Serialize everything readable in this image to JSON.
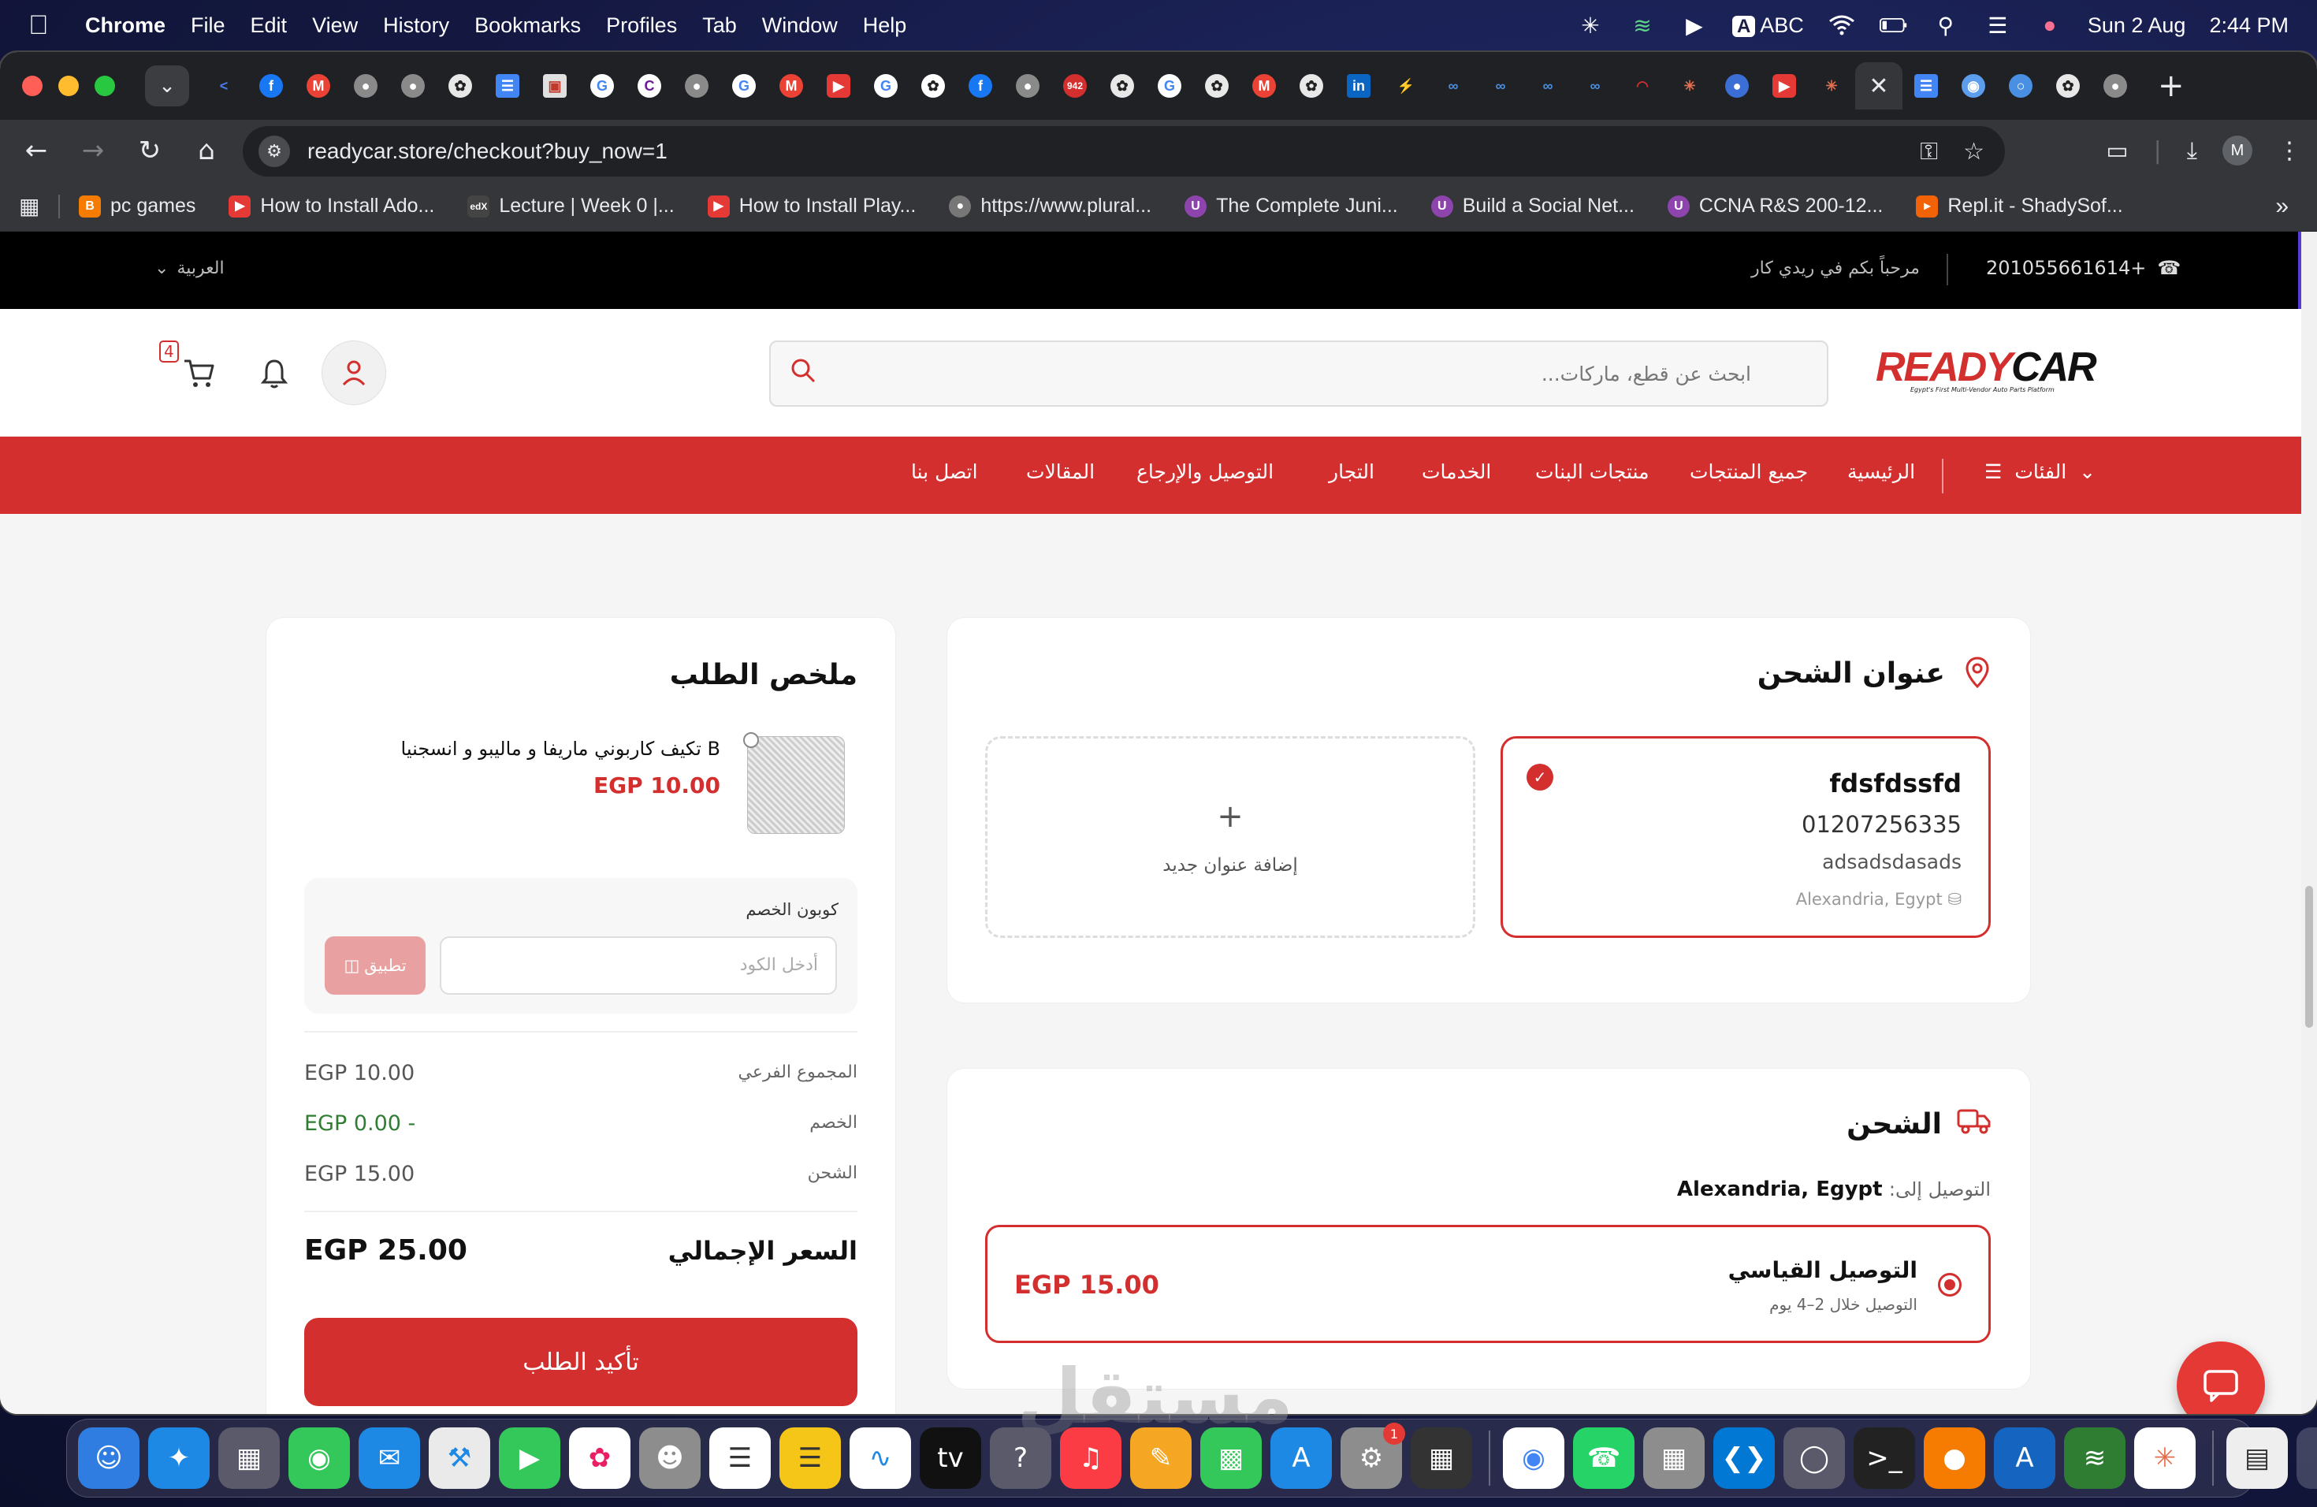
{
  "menubar": {
    "app_name": "Chrome",
    "menus": [
      "File",
      "Edit",
      "View",
      "History",
      "Bookmarks",
      "Profiles",
      "Tab",
      "Window",
      "Help"
    ],
    "input_source": "ABC",
    "date": "Sun 2 Aug",
    "time": "2:44 PM"
  },
  "browser": {
    "url": "readycar.store/checkout?buy_now=1",
    "profile_initial": "M",
    "tab_badge": "942",
    "bookmarks": [
      {
        "label": "pc games",
        "icon": "blogger-icon",
        "color": "#f57c00"
      },
      {
        "label": "How to Install Ado...",
        "icon": "youtube-icon",
        "color": "#e53935"
      },
      {
        "label": "Lecture | Week 0 |...",
        "icon": "edx-icon",
        "color": "#444444"
      },
      {
        "label": "How to Install Play...",
        "icon": "youtube-icon",
        "color": "#e53935"
      },
      {
        "label": "https://www.plural...",
        "icon": "globe-icon",
        "color": "#777777"
      },
      {
        "label": "The Complete Juni...",
        "icon": "udemy-icon",
        "color": "#8e44ad"
      },
      {
        "label": "Build a Social Net...",
        "icon": "udemy-icon",
        "color": "#8e44ad"
      },
      {
        "label": "CCNA R&S 200-12...",
        "icon": "udemy-icon",
        "color": "#8e44ad"
      },
      {
        "label": "Repl.it - ShadySof...",
        "icon": "replit-icon",
        "color": "#f26207"
      }
    ]
  },
  "site": {
    "topbar": {
      "language": "العربية",
      "welcome": "مرحباً بكم في ريدي كار",
      "phone": "201055661614+"
    },
    "header": {
      "search_placeholder": "ابحث عن قطع، ماركات...",
      "cart_count": "4",
      "logo_text_a": "READY",
      "logo_text_b": "CAR",
      "logo_tagline": "Egypt's First Multi-Vendor Auto Parts Platform"
    },
    "nav": {
      "categories": "الفئات",
      "items": [
        "الرئيسية",
        "جميع المنتجات",
        "منتجات البنات",
        "الخدمات",
        "التجار",
        "التوصيل والإرجاع",
        "المقالات",
        "اتصل بنا"
      ]
    },
    "shipping_address": {
      "title": "عنوان الشحن",
      "selected": {
        "name": "fdsfdssfd",
        "phone": "01207256335",
        "street": "adsadsdasads",
        "city": "Alexandria, Egypt"
      },
      "add_new_label": "إضافة عنوان جديد"
    },
    "shipping": {
      "title": "الشحن",
      "deliver_to_label": "التوصيل إلى:",
      "deliver_to_value": "Alexandria, Egypt",
      "option_title": "التوصيل القياسي",
      "option_subtitle": "التوصيل خلال 2–4 يوم",
      "option_price": "EGP 15.00"
    },
    "order_summary": {
      "title": "ملخص الطلب",
      "product_name": "B تكيف كاربوني ماريفا و ماليبو و انسجنيا",
      "product_price": "EGP 10.00",
      "coupon_label": "كوبون الخصم",
      "coupon_placeholder": "أدخل الكود",
      "apply_label": "تطبيق",
      "subtotal_label": "المجموع الفرعي",
      "subtotal_value": "EGP 10.00",
      "discount_label": "الخصم",
      "discount_value": "EGP 0.00 -",
      "shipping_label": "الشحن",
      "shipping_value": "EGP 15.00",
      "total_label": "السعر الإجمالي",
      "total_value": "EGP 25.00",
      "confirm_label": "تأكيد الطلب"
    }
  },
  "watermark": "مستقل",
  "colors": {
    "brand_red": "#d32f2f",
    "topbar_black": "#000000",
    "page_bg": "#f5f5f5"
  }
}
